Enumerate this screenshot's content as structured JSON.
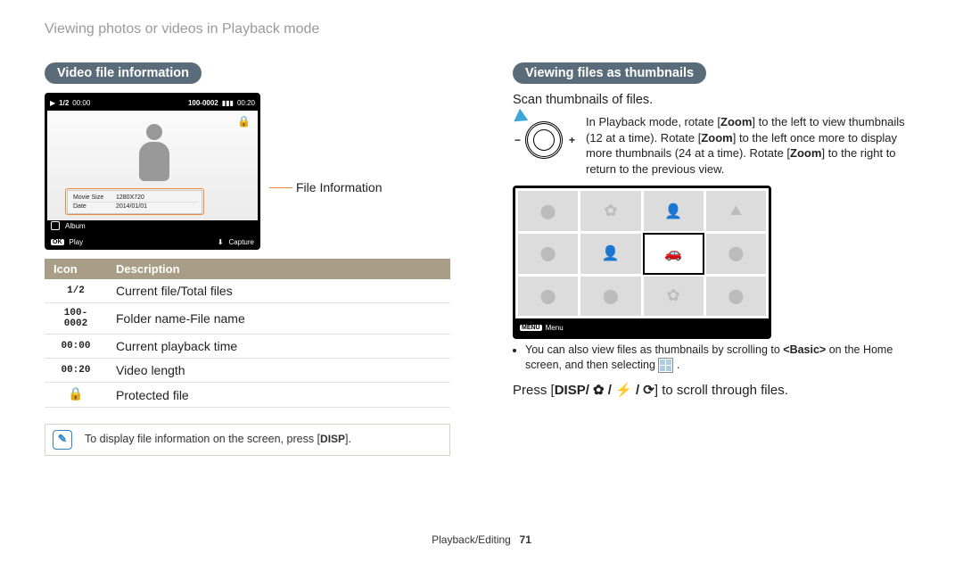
{
  "breadcrumb": "Viewing photos or videos in Playback mode",
  "left": {
    "heading": "Video file information",
    "file_info_label": "File Information",
    "screen": {
      "play_icon": "▶",
      "counter": "1/2",
      "time_current": "00:00",
      "folder_file": "100-0002",
      "battery": "▮▮▮",
      "duration": "00:20",
      "lock": "🔒",
      "info_rows": [
        [
          "Movie Size",
          "1280X720"
        ],
        [
          "Date",
          "2014/01/01"
        ]
      ],
      "album_label": "Album",
      "ok_chip": "OK",
      "play_label": "Play",
      "capture_label": "Capture"
    },
    "table": {
      "head_icon": "Icon",
      "head_desc": "Description",
      "rows": [
        {
          "icon": "1/2",
          "desc": "Current file/Total files"
        },
        {
          "icon": "100-0002",
          "desc": "Folder name-File name"
        },
        {
          "icon": "00:00",
          "desc": "Current playback time"
        },
        {
          "icon": "00:20",
          "desc": "Video length"
        },
        {
          "icon": "🔒",
          "desc": "Protected file"
        }
      ]
    },
    "note": {
      "text_before": "To display file information on the screen, press [",
      "key": "DISP",
      "text_after": "]."
    }
  },
  "right": {
    "heading": "Viewing files as thumbnails",
    "scan_line": "Scan thumbnails of files.",
    "zoom_text_parts": {
      "p1": "In Playback mode, rotate [",
      "z": "Zoom",
      "p2": "] to the left to view thumbnails (12 at a time). Rotate [",
      "p3": "] to the left once more to display more thumbnails (24 at a time). Rotate [",
      "p4": "] to the right to return to the previous view."
    },
    "thumb_bottom": {
      "menu_chip": "MENU",
      "menu_label": "Menu"
    },
    "bullet": {
      "b1": "You can also view files as thumbnails by scrolling to ",
      "basic": "<Basic>",
      "b2": " on the Home screen, and then selecting ",
      "b3": " ."
    },
    "press_line": {
      "p1": "Press [",
      "keys": "DISP/ ✿ / ⚡ / ⟳",
      "p2": "] to scroll through files."
    }
  },
  "footer": {
    "section": "Playback/Editing",
    "page": "71"
  }
}
